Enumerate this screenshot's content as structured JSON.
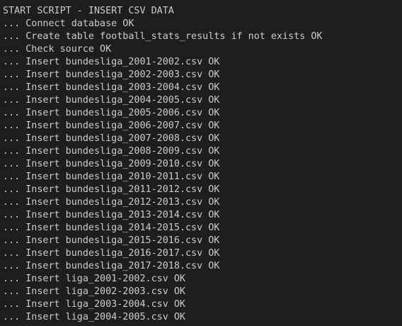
{
  "terminal": {
    "lines": [
      "START SCRIPT - INSERT CSV DATA",
      "... Connect database OK",
      "... Create table football_stats_results if not exists OK",
      "... Check source OK",
      "... Insert bundesliga_2001-2002.csv OK",
      "... Insert bundesliga_2002-2003.csv OK",
      "... Insert bundesliga_2003-2004.csv OK",
      "... Insert bundesliga_2004-2005.csv OK",
      "... Insert bundesliga_2005-2006.csv OK",
      "... Insert bundesliga_2006-2007.csv OK",
      "... Insert bundesliga_2007-2008.csv OK",
      "... Insert bundesliga_2008-2009.csv OK",
      "... Insert bundesliga_2009-2010.csv OK",
      "... Insert bundesliga_2010-2011.csv OK",
      "... Insert bundesliga_2011-2012.csv OK",
      "... Insert bundesliga_2012-2013.csv OK",
      "... Insert bundesliga_2013-2014.csv OK",
      "... Insert bundesliga_2014-2015.csv OK",
      "... Insert bundesliga_2015-2016.csv OK",
      "... Insert bundesliga_2016-2017.csv OK",
      "... Insert bundesliga_2017-2018.csv OK",
      "... Insert liga_2001-2002.csv OK",
      "... Insert liga_2002-2003.csv OK",
      "... Insert liga_2003-2004.csv OK",
      "... Insert liga_2004-2005.csv OK"
    ]
  }
}
